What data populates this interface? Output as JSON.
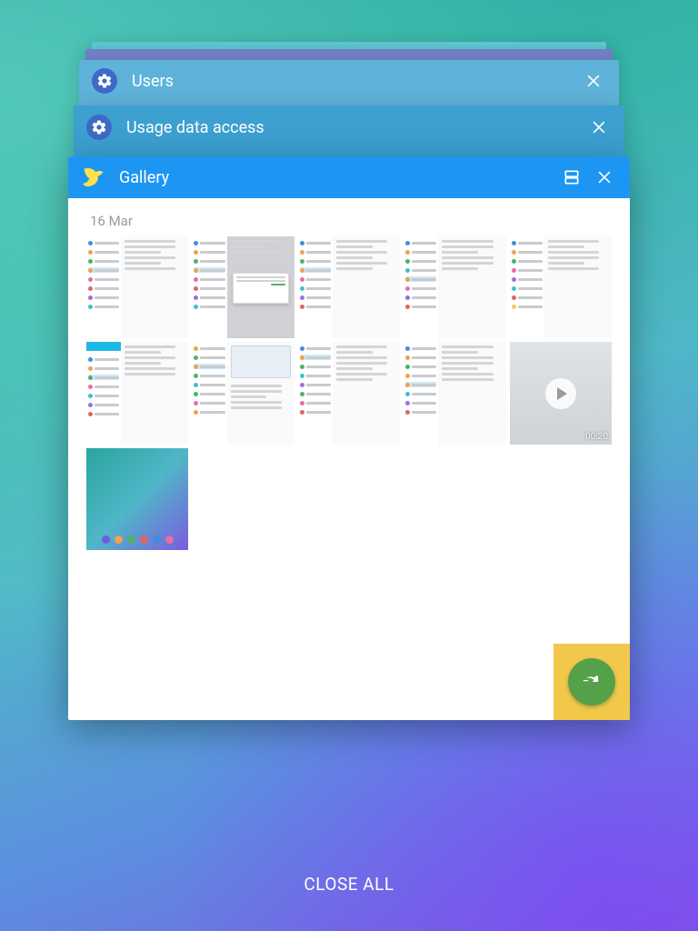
{
  "cards": {
    "rear": [
      {
        "title": "Users"
      },
      {
        "title": "Usage data access"
      }
    ],
    "front": {
      "title": "Gallery",
      "date_header": "16 Mar",
      "video_duration": "00:20"
    }
  },
  "close_all_label": "CLOSE ALL",
  "icons": {
    "settings": "gear-icon",
    "gallery": "bird-icon",
    "split": "split-screen-icon",
    "close": "close-icon",
    "pin": "pin-icon",
    "play": "play-icon"
  }
}
